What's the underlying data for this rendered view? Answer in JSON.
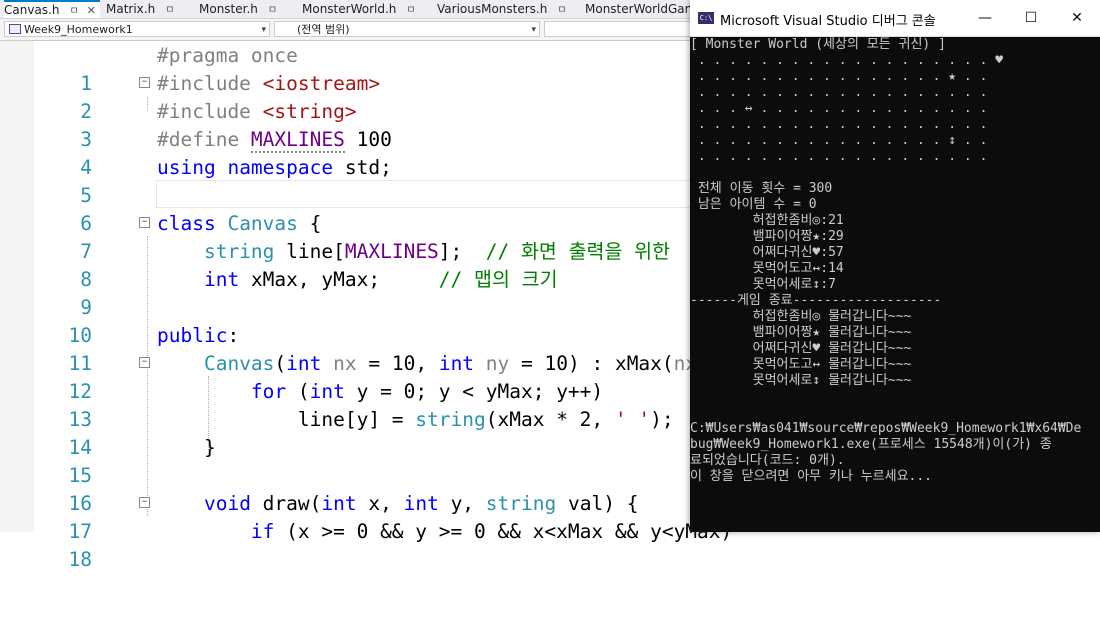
{
  "tabs": [
    {
      "label": "Canvas.h",
      "pin": "ㅁ",
      "close": "✕",
      "active": true
    },
    {
      "label": "Matrix.h",
      "pin": "ㅁ",
      "active": false
    },
    {
      "label": "Monster.h",
      "pin": "ㅁ",
      "active": false
    },
    {
      "label": "MonsterWorld.h",
      "pin": "ㅁ",
      "active": false
    },
    {
      "label": "VariousMonsters.h",
      "pin": "ㅁ",
      "active": false
    },
    {
      "label": "MonsterWorldGame",
      "active": false
    }
  ],
  "nav": {
    "project": "Week9_Homework1",
    "scope": "(전역 범위)",
    "member": ""
  },
  "editor": {
    "line_numbers": [
      "1",
      "2",
      "3",
      "4",
      "5",
      "6",
      "7",
      "8",
      "9",
      "10",
      "11",
      "12",
      "13",
      "14",
      "15",
      "16",
      "17",
      "18"
    ],
    "lines": {
      "l1": {
        "pp": "#pragma once"
      },
      "l2": {
        "pp": "#include ",
        "st": "<iostream>"
      },
      "l3": {
        "pp": "#include ",
        "st": "<string>"
      },
      "l4": {
        "pp": "#define ",
        "mc": "MAXLINES",
        "tx": " 100"
      },
      "l5": {
        "kw1": "using",
        "sp1": " ",
        "kw2": "namespace",
        "tx": " std;"
      },
      "l7": {
        "kw": "class",
        "sp": " ",
        "ty": "Canvas",
        "tx": " {"
      },
      "l8": {
        "ind": "    ",
        "ty": "string",
        "tx1": " line[",
        "mc": "MAXLINES",
        "tx2": "];  ",
        "cm": "// 화면 출력을 위한"
      },
      "l9": {
        "ind": "    ",
        "kw": "int",
        "tx": " xMax, yMax;     ",
        "cm": "// 맵의 크기"
      },
      "l11": {
        "kw": "public",
        "tx": ":"
      },
      "l12": {
        "ind": "    ",
        "ty": "Canvas",
        "tx1": "(",
        "kw1": "int",
        "pm1": " nx",
        "tx2": " = 10, ",
        "kw2": "int",
        "pm2": " ny",
        "tx3": " = 10) : xMax(",
        "pm3": "nx",
        "tx4": ")"
      },
      "l13": {
        "ind": "        ",
        "kw1": "for",
        "tx1": " (",
        "kw2": "int",
        "tx2": " y = 0; y < yMax; y++)"
      },
      "l14": {
        "ind": "            ",
        "tx1": "line[y] = ",
        "ty": "string",
        "tx2": "(xMax * 2, ",
        "st": "' '",
        "tx3": ");"
      },
      "l15": {
        "ind": "    ",
        "tx": "}"
      },
      "l17": {
        "ind": "    ",
        "kw1": "void",
        "tx1": " draw(",
        "kw2": "int",
        "tx2": " x, ",
        "kw3": "int",
        "tx3": " y, ",
        "ty": "string",
        "tx4": " val) {"
      },
      "l18": {
        "ind": "        ",
        "kw": "if",
        "tx": " (x >= 0 && y >= 0 && x<xMax && y<yMax)"
      }
    }
  },
  "console": {
    "title": "Microsoft Visual Studio 디버그 콘솔",
    "icon_text": "C:\\",
    "minimize": "—",
    "maximize": "☐",
    "close": "✕",
    "lines": [
      "[ Monster World (세상의 모든 귀신) ]",
      " . . . . . . . . . . . . . . . . . . . ♥",
      " . . . . . . . . . . . . . . . . ★ . .",
      " . . . . . . . . . . . . . . . . . . .",
      " . . . ↔ . . . . . . . . . . . . . . .",
      " . . . . . . . . . . . . . . . . . . .",
      " . . . . . . . . . . . . . . . . ↕ . .",
      " . . . . . . . . . . . . . . . . . . .",
      "",
      " 전체 이동 횟수 = 300",
      " 남은 아이템 수 = 0",
      "        허접한좀비◎:21",
      "        뱀파이어짱★:29",
      "        어쩌다귀신♥:57",
      "        못먹어도고↔:14",
      "        못먹어세로↕:7",
      "------게임 종료-------------------",
      "        허접한좀비◎ 물러갑니다~~~",
      "        뱀파이어짱★ 물러갑니다~~~",
      "        어쩌다귀신♥ 물러갑니다~~~",
      "        못먹어도고↔ 물러갑니다~~~",
      "        못먹어세로↕ 물러갑니다~~~",
      "",
      "",
      "C:₩Users₩as041₩source₩repos₩Week9_Homework1₩x64₩De",
      "bug₩Week9_Homework1.exe(프로세스 15548개)이(가) 종",
      "료되었습니다(코드: 0개).",
      "이 창을 닫으려면 아무 키나 누르세요..."
    ]
  }
}
